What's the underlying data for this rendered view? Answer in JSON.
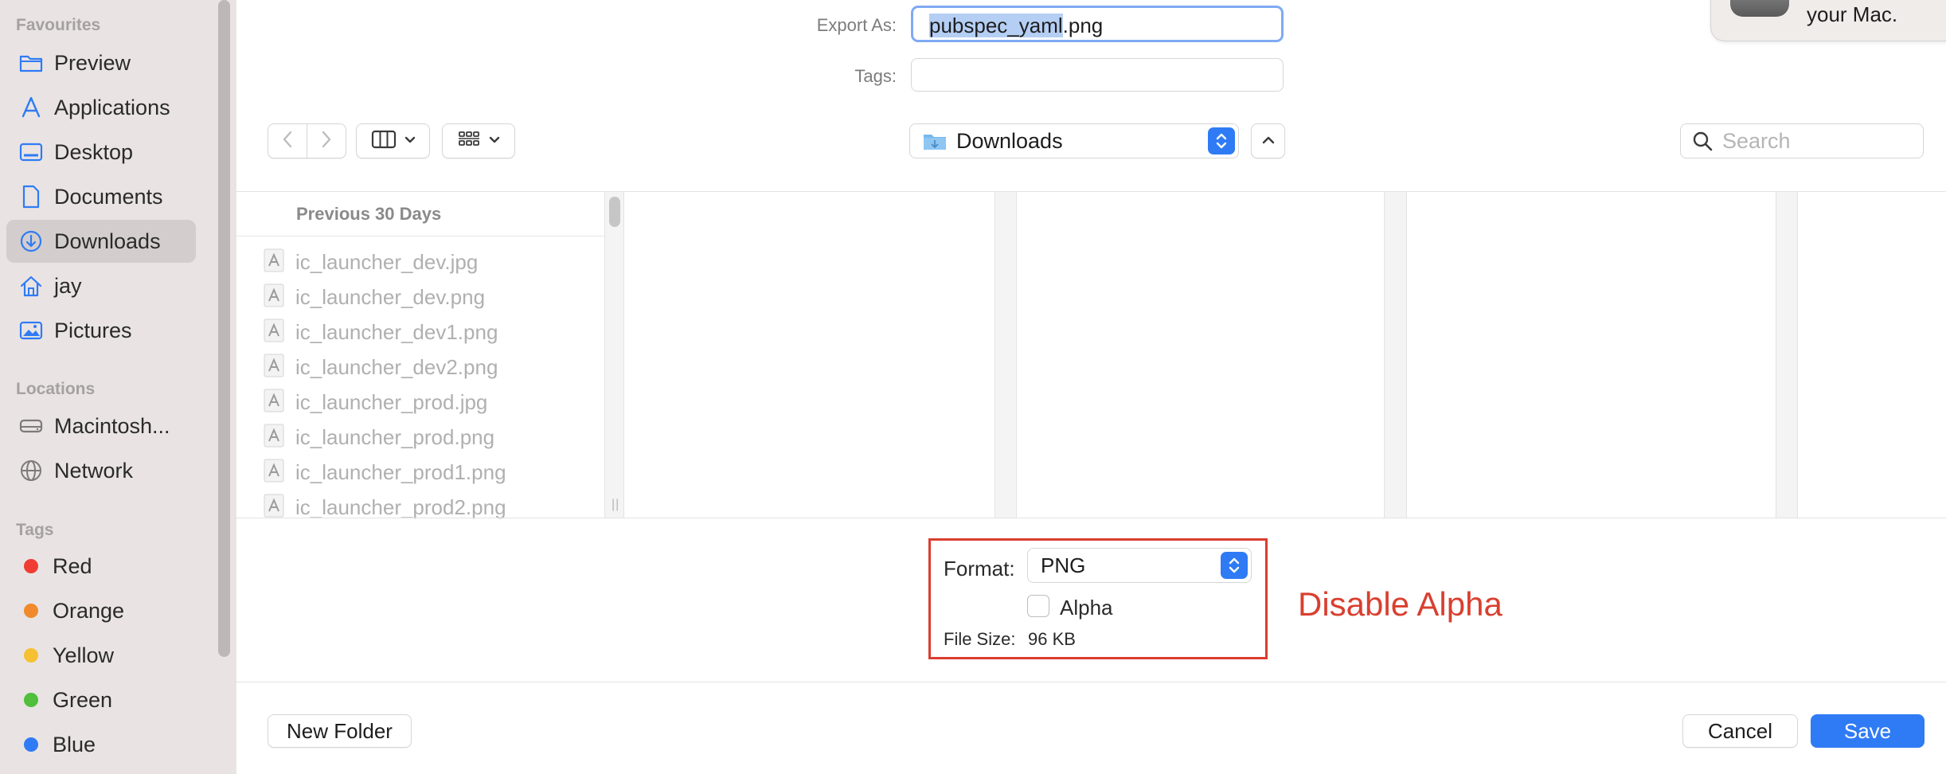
{
  "sidebar": {
    "favourites_heading": "Favourites",
    "favourites": [
      {
        "label": "Preview",
        "icon": "folder-icon"
      },
      {
        "label": "Applications",
        "icon": "applications-icon"
      },
      {
        "label": "Desktop",
        "icon": "desktop-icon"
      },
      {
        "label": "Documents",
        "icon": "document-icon"
      },
      {
        "label": "Downloads",
        "icon": "download-icon",
        "selected": true
      },
      {
        "label": "jay",
        "icon": "home-icon"
      },
      {
        "label": "Pictures",
        "icon": "pictures-icon"
      }
    ],
    "locations_heading": "Locations",
    "locations": [
      {
        "label": "Macintosh...",
        "icon": "disk-icon"
      },
      {
        "label": "Network",
        "icon": "network-icon"
      }
    ],
    "tags_heading": "Tags",
    "tags": [
      {
        "label": "Red",
        "color": "#ef3d34"
      },
      {
        "label": "Orange",
        "color": "#f08a2c"
      },
      {
        "label": "Yellow",
        "color": "#f6c032"
      },
      {
        "label": "Green",
        "color": "#4fbf3c"
      },
      {
        "label": "Blue",
        "color": "#2f7bf5"
      }
    ]
  },
  "form": {
    "export_as_label": "Export As:",
    "export_selected": "pubspec_yaml",
    "export_extension": ".png",
    "tags_label": "Tags:"
  },
  "toolbar": {
    "location": "Downloads",
    "search_placeholder": "Search"
  },
  "browser": {
    "section_heading": "Previous 30 Days",
    "files": [
      "ic_launcher_dev.jpg",
      "ic_launcher_dev.png",
      "ic_launcher_dev1.png",
      "ic_launcher_dev2.png",
      "ic_launcher_prod.jpg",
      "ic_launcher_prod.png",
      "ic_launcher_prod1.png",
      "ic_launcher_prod2.png"
    ]
  },
  "accessory": {
    "format_label": "Format:",
    "format_value": "PNG",
    "alpha_label": "Alpha",
    "alpha_checked": false,
    "file_size_label": "File Size:",
    "file_size_value": "96 KB"
  },
  "annotation": "Disable Alpha",
  "buttons": {
    "new_folder": "New Folder",
    "cancel": "Cancel",
    "save": "Save"
  },
  "notification": {
    "text": "your Mac."
  },
  "colors": {
    "accent": "#2f7bf5",
    "annotation": "#d93f2f",
    "sidebar_bg": "#e9e4e3"
  }
}
